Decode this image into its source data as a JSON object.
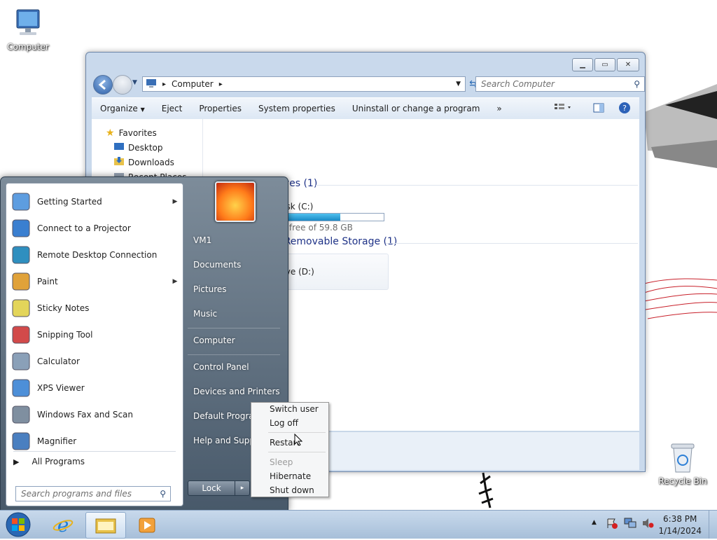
{
  "desktop": {
    "computer_label": "Computer",
    "recycle_bin_label": "Recycle Bin"
  },
  "explorer": {
    "address": {
      "root_arrow": "▸",
      "location": "Computer",
      "trail_arrow": "▸"
    },
    "search_placeholder": "Search Computer",
    "toolbar": {
      "organize": "Organize",
      "eject": "Eject",
      "properties": "Properties",
      "system_properties": "System properties",
      "uninstall": "Uninstall or change a program",
      "more": "»"
    },
    "navpane": {
      "favorites": "Favorites",
      "desktop": "Desktop",
      "downloads": "Downloads",
      "recent_places": "Recent Places"
    },
    "hard_disk_group": "Hard Disk Drives (1)",
    "local_disk": {
      "name": "Local Disk (C:)",
      "free_text": "20.0 GB free of 59.8 GB",
      "used_fraction": 0.665
    },
    "removable_group": "Devices with Removable Storage (1)",
    "dvd_drive": {
      "name": "DVD Drive (D:)"
    }
  },
  "start_menu": {
    "programs": [
      {
        "label": "Getting Started",
        "submenu": true,
        "icon": "getting-started-icon"
      },
      {
        "label": "Connect to a Projector",
        "submenu": false,
        "icon": "projector-icon"
      },
      {
        "label": "Remote Desktop Connection",
        "submenu": false,
        "icon": "remote-desktop-icon"
      },
      {
        "label": "Paint",
        "submenu": true,
        "icon": "paint-icon"
      },
      {
        "label": "Sticky Notes",
        "submenu": false,
        "icon": "sticky-notes-icon"
      },
      {
        "label": "Snipping Tool",
        "submenu": false,
        "icon": "snipping-tool-icon"
      },
      {
        "label": "Calculator",
        "submenu": false,
        "icon": "calculator-icon"
      },
      {
        "label": "XPS Viewer",
        "submenu": false,
        "icon": "xps-viewer-icon"
      },
      {
        "label": "Windows Fax and Scan",
        "submenu": false,
        "icon": "fax-scan-icon"
      },
      {
        "label": "Magnifier",
        "submenu": false,
        "icon": "magnifier-icon"
      }
    ],
    "all_programs": "All Programs",
    "search_placeholder": "Search programs and files",
    "right": {
      "user": "VM1",
      "documents": "Documents",
      "pictures": "Pictures",
      "music": "Music",
      "computer": "Computer",
      "control_panel": "Control Panel",
      "devices_printers": "Devices and Printers",
      "default_programs": "Default Programs",
      "help_support": "Help and Support"
    },
    "lock_label": "Lock",
    "lock_arrow": "▸"
  },
  "power_menu": {
    "switch_user": "Switch user",
    "log_off": "Log off",
    "restart": "Restart",
    "sleep": "Sleep",
    "hibernate": "Hibernate",
    "shut_down": "Shut down"
  },
  "taskbar": {
    "time": "6:38 PM",
    "date": "1/14/2024"
  },
  "colors": {
    "accent": "#1e3287",
    "progress": "#1f9fd8"
  }
}
